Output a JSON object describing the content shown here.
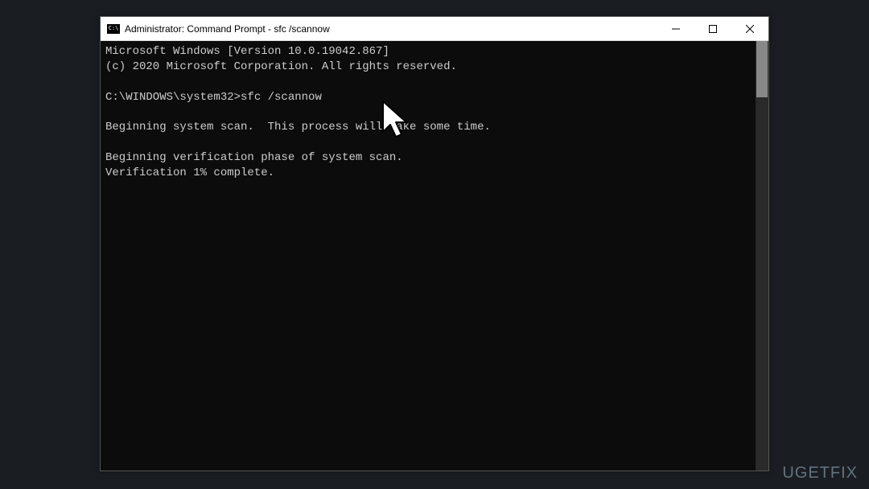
{
  "window": {
    "icon_text": "C:\\",
    "title": "Administrator: Command Prompt - sfc  /scannow"
  },
  "console": {
    "lines": [
      "Microsoft Windows [Version 10.0.19042.867]",
      "(c) 2020 Microsoft Corporation. All rights reserved.",
      "",
      "C:\\WINDOWS\\system32>sfc /scannow",
      "",
      "Beginning system scan.  This process will take some time.",
      "",
      "Beginning verification phase of system scan.",
      "Verification 1% complete."
    ]
  },
  "watermark": {
    "text": "UGETFIX"
  }
}
